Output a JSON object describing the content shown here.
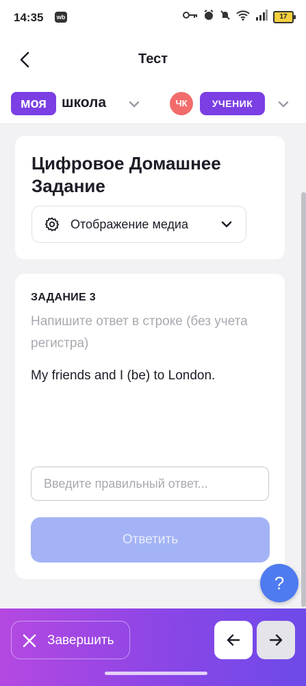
{
  "status_bar": {
    "time": "14:35",
    "badge": "wb",
    "battery": "17",
    "icons": [
      "key-icon",
      "alarm-icon",
      "mute-icon",
      "wifi-icon",
      "signal-icon",
      "battery-icon"
    ]
  },
  "header": {
    "title": "Тест"
  },
  "brand": {
    "logo_box": "моя",
    "logo_text": "школа",
    "avatar_initials": "ЧК",
    "role": "УЧЕНИК"
  },
  "homework": {
    "title": "Цифровое Домашнее Задание",
    "media_label": "Отображение медиа"
  },
  "task": {
    "number": "ЗАДАНИЕ 3",
    "instruction": "Напишите ответ в строке (без учета регистра)",
    "text": "My friends and I (be) to London.",
    "input_value": "",
    "input_placeholder": "Введите правильный ответ...",
    "submit_label": "Ответить"
  },
  "help": {
    "label": "?"
  },
  "footer": {
    "finish_label": "Завершить"
  },
  "colors": {
    "brand_purple": "#7b3fe4",
    "avatar": "#f26c6c",
    "submit_disabled": "#a3b3f5",
    "help": "#4f7bf0",
    "footer_gradient": [
      "#b548e1",
      "#6d4ae9"
    ]
  }
}
